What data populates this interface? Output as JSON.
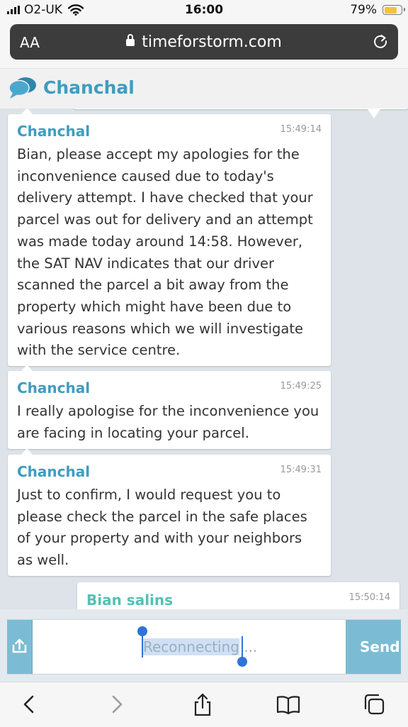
{
  "status_bar": {
    "carrier": "O2-UK",
    "time": "16:00",
    "battery_percent": "79%",
    "battery_level": 0.79
  },
  "browser": {
    "text_size_label": "AA",
    "url": "timeforstorm.com"
  },
  "header": {
    "app_name": "Chanchal"
  },
  "messages": [
    {
      "sender": "Chanchal",
      "time": "15:49:14",
      "text": "Bian, please accept my apologies for the inconvenience caused due to today's delivery attempt. I have checked that your parcel was out for delivery and an attempt was made today around 14:58. However, the SAT NAV indicates that our driver scanned the parcel a bit away from the property which might have been due to various reasons which we will investigate with the service centre."
    },
    {
      "sender": "Chanchal",
      "time": "15:49:25",
      "text": "I really apologise for the inconvenience you are facing in locating your parcel."
    },
    {
      "sender": "Chanchal",
      "time": "15:49:31",
      "text": "Just to confirm, I would request you to please check the parcel in the safe places of your property and with your neighbors as well."
    },
    {
      "sender": "Bian salins",
      "time": "15:50:14",
      "text": ""
    }
  ],
  "input": {
    "selected_text": "Reconnecting",
    "trailing_text": " ...",
    "send_label": "Send"
  },
  "colors": {
    "accent": "#3f9dc0",
    "chat_bg": "#dde3e8",
    "button": "#7bbcd4",
    "user_name": "#54c1b4",
    "selection": "#2d74d6"
  },
  "icons": {
    "chat_logo": "chat-bubbles-icon",
    "upload": "upload-icon",
    "lock": "lock-icon",
    "reload": "reload-icon",
    "toolbar": [
      "back-icon",
      "forward-icon",
      "share-icon",
      "bookmarks-icon",
      "tabs-icon"
    ]
  }
}
